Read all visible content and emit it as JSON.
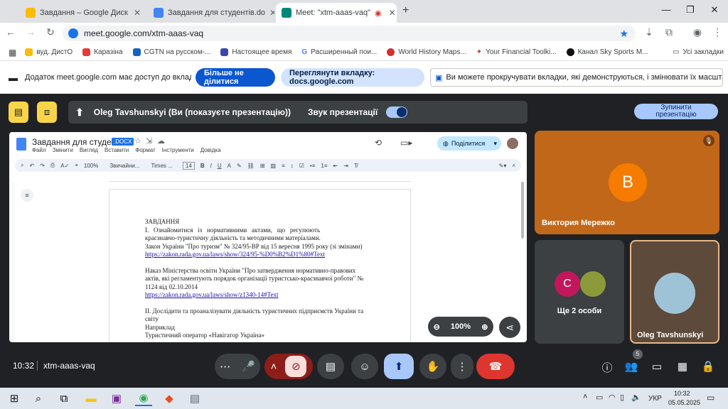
{
  "browser": {
    "tabs": [
      {
        "title": "Завдання – Google Диск",
        "color": "#fbbc04"
      },
      {
        "title": "Завдання для студентів.do",
        "color": "#4285f4"
      },
      {
        "title": "Meet: \"xtm-aaas-vaq\"",
        "color": "#00897b"
      }
    ],
    "url": "meet.google.com/xtm-aaas-vaq",
    "bookmarks": [
      "вуд. ДистО",
      "Каразіна",
      "CGTN на русском-...",
      "Настоящее время",
      "Расширенный пои...",
      "World History Maps...",
      "Your Financial Toolki...",
      "Канал Sky Sports M..."
    ],
    "all_bookmarks": "Усі закладки"
  },
  "share_bar": {
    "message": "Додаток meet.google.com має доступ до вкладки...",
    "stop_label": "Більше не ділитися",
    "view_label": "Переглянути вкладку: docs.google.com",
    "info": "Ви можете прокручувати вкладки, які демонструються, і змінювати їх масштаб"
  },
  "meet": {
    "presenter_text": "Oleg Tavshunskyi (Ви (показуєте презентацію))",
    "sound_label": "Звук презентації",
    "stop_present": "Зупинити презентацію",
    "zoom": "100%",
    "time": "10:32",
    "code": "xtm-aaas-vaq",
    "participants_count": "5",
    "participants": [
      {
        "name": "Виктория Мережко",
        "initial": "B",
        "color": "#f57c00"
      },
      {
        "name": "Ще 2 особи",
        "initial": "C",
        "color": "#c2185b"
      },
      {
        "name": "Oleg Tavshunskyi"
      }
    ]
  },
  "doc": {
    "title": "Завдання для студентів",
    "badge": ".DOCX",
    "menu": [
      "Файл",
      "Змінити",
      "Вигляд",
      "Вставити",
      "Формат",
      "Інструменти",
      "Довідка"
    ],
    "share_label": "Поділитися",
    "zoom": "100%",
    "style": "Звичайни...",
    "font": "Times ...",
    "font_size": "14",
    "lines": [
      "ЗАВДАННЯ",
      "І.   Ознайомитися   із   нормативними   актами,   що   регулюють",
      "краєзнавчо-туристичну діяльність та методичними матеріалами.",
      "Закон України \"Про туризм\" № 324/95-ВР від 15 вересня 1995 року (зі змінами)",
      "https://zakon.rada.gov.ua/laws/show/324/95-%D0%B2%D1%80#Text",
      "",
      "Наказ Міністерства освіти України \"Про затвердження нормативно-правових",
      "актів, які регламентують порядок організації туристсько-краєзнавчої роботи\" №",
      "1124 від 02.10.2014",
      "https://zakon.rada.gov.ua/laws/show/z1340-14#Text",
      "",
      "ІІ. Дослідити та проаналізувати діяльність туристичних підприємств України та",
      "світу",
      "Наприклад",
      "Туристичний оператор «Навігатор Україна»"
    ]
  },
  "taskbar": {
    "lang": "УКР",
    "time": "10:32",
    "date": "05.05.2025"
  }
}
